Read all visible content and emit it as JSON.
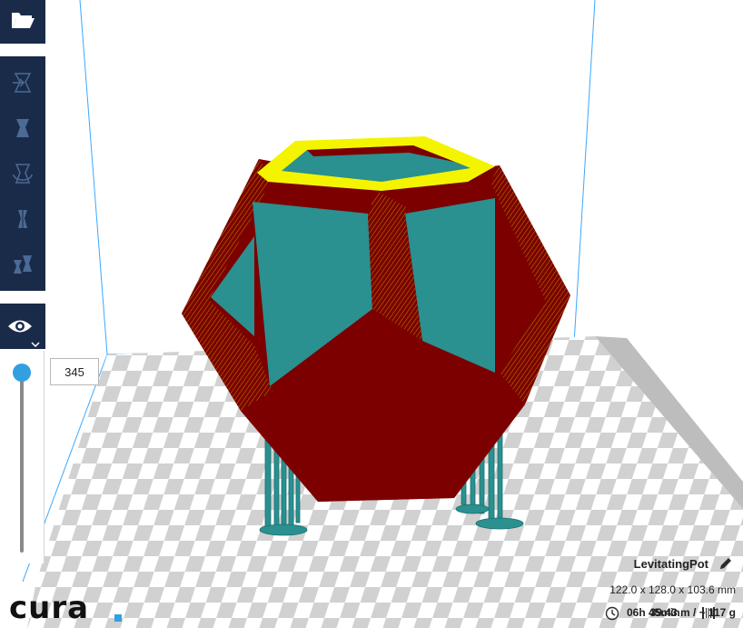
{
  "app": {
    "logo_text": "cura"
  },
  "toolbar": {
    "open_icon": "folder-open-icon",
    "tools": [
      {
        "name": "move-tool",
        "icon": "move-icon"
      },
      {
        "name": "scale-tool",
        "icon": "scale-icon"
      },
      {
        "name": "rotate-tool",
        "icon": "rotate-icon"
      },
      {
        "name": "mirror-tool",
        "icon": "mirror-icon"
      },
      {
        "name": "per-model-settings-tool",
        "icon": "per-model-settings-icon"
      }
    ],
    "view_icon": "eye-icon"
  },
  "layer_view": {
    "current_layer": "345"
  },
  "job": {
    "name": "LevitatingPot",
    "dimensions": "122.0 x 128.0 x 103.6 mm",
    "print_time": "06h 45min",
    "material": "39.43 m / ~ 117 g"
  },
  "colors": {
    "toolbar_bg": "#1a2b4a",
    "accent": "#32a0e0",
    "wall_outer": "#7c0000",
    "top_skin": "#f4f400",
    "support_infill": "#2a9090",
    "bed_light": "#ffffff",
    "bed_dark": "#d0d0d0"
  }
}
